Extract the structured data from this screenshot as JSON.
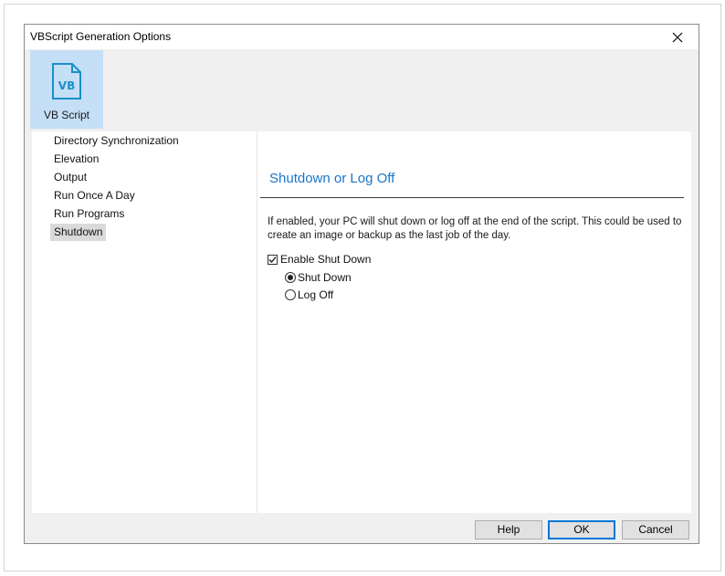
{
  "window": {
    "title": "VBScript Generation Options"
  },
  "ribbon": {
    "button": {
      "icon": "vb-script-file-icon",
      "icon_text": "VB",
      "label": "VB Script"
    }
  },
  "nav": {
    "items": [
      {
        "label": "Directory Synchronization"
      },
      {
        "label": "Elevation"
      },
      {
        "label": "Output"
      },
      {
        "label": "Run Once A Day"
      },
      {
        "label": "Run Programs"
      },
      {
        "label": "Shutdown",
        "selected": true
      }
    ]
  },
  "content": {
    "title": "Shutdown or Log Off",
    "description": "If enabled, your PC will shut down or log off at the end of the script. This could be used to create an image or backup as the last job of the day.",
    "enable_checkbox": {
      "label": "Enable Shut Down",
      "checked": true
    },
    "options": [
      {
        "label": "Shut Down",
        "selected": true
      },
      {
        "label": "Log Off",
        "selected": false
      }
    ]
  },
  "buttons": {
    "help": "Help",
    "ok": "OK",
    "cancel": "Cancel"
  },
  "colors": {
    "accent": "#1976c8",
    "ribbon_selected": "#c4dff6",
    "default_button_border": "#0078d7"
  }
}
